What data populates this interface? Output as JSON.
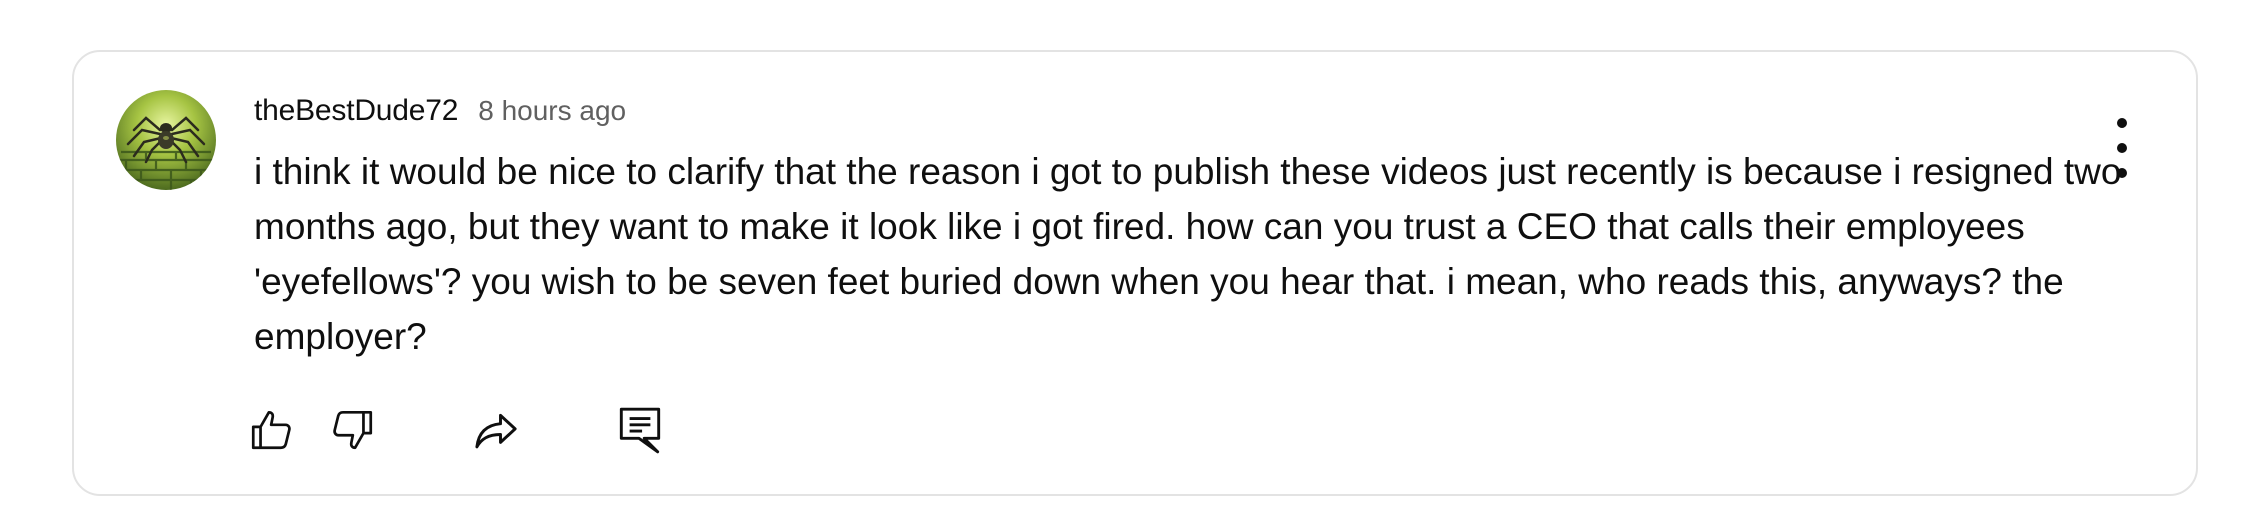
{
  "comment": {
    "author": "theBestDude72",
    "timestamp": "8 hours ago",
    "text": "i think it would be nice to clarify that the reason i got to publish these videos just recently is because i resigned two months ago, but they want to make it look like i got fired. how can you trust a CEO that calls their employees 'eyefellows'? you wish to be seven feet buried down when you hear that. i mean, who reads this, anyways? the employer?"
  },
  "avatar": {
    "icon": "spider-avatar-icon",
    "colors": {
      "background": "#9bb83c",
      "maze": "#3f5a1c"
    }
  },
  "actions": [
    {
      "name": "like-button",
      "icon": "thumbs-up-icon"
    },
    {
      "name": "dislike-button",
      "icon": "thumbs-down-icon"
    },
    {
      "name": "share-button",
      "icon": "share-arrow-icon"
    },
    {
      "name": "reply-button",
      "icon": "comment-icon"
    }
  ],
  "menu": {
    "icon": "more-vertical-icon"
  },
  "colors": {
    "text": "#0f0f0f",
    "secondary_text": "#606060",
    "card_border": "#e3e3e3"
  }
}
